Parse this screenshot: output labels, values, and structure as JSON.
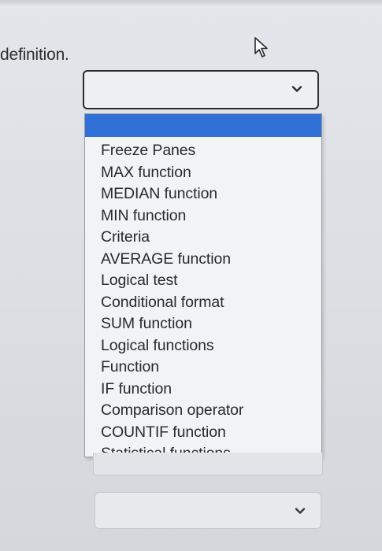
{
  "question": {
    "text": "definition."
  },
  "dropdown": {
    "selected_value": "",
    "highlighted_option": "",
    "options": [
      "Freeze Panes",
      "MAX function",
      "MEDIAN function",
      "MIN function",
      "Criteria",
      "AVERAGE function",
      "Logical test",
      "Conditional format",
      "SUM function",
      "Logical functions",
      "Function",
      "IF function",
      "Comparison operator",
      "COUNTIF function",
      "Statistical functions"
    ]
  },
  "second_dropdown": {
    "selected_value": ""
  },
  "icons": {
    "cursor": "mouse-pointer-icon",
    "dropdown_arrow": "chevron-down-icon"
  },
  "colors": {
    "highlight": "#2f6fd6",
    "border": "#2c2c2c",
    "background": "#e0e3e7"
  }
}
